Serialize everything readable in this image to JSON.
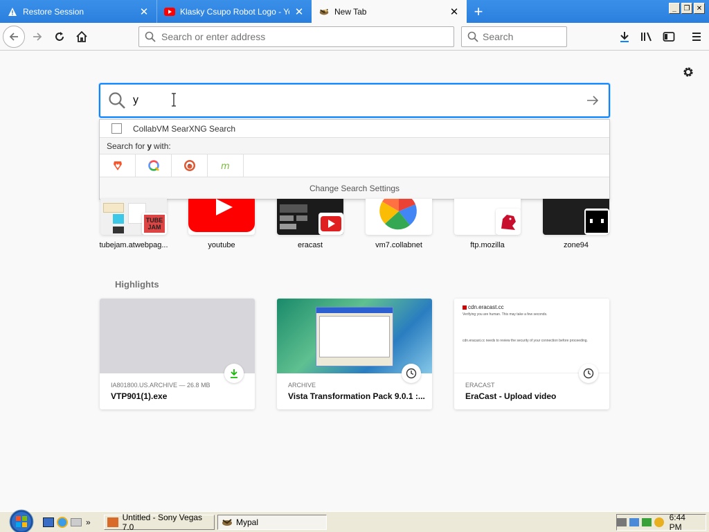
{
  "tabs": [
    {
      "title": "Restore Session",
      "icon": "warning-icon"
    },
    {
      "title": "Klasky Csupo Robot Logo - YouTube",
      "icon": "youtube-icon"
    },
    {
      "title": "New Tab",
      "icon": "mypal-icon"
    }
  ],
  "toolbar": {
    "url_placeholder": "Search or enter address",
    "search_placeholder": "Search"
  },
  "search": {
    "query": "y",
    "suggestion": "CollabVM SearXNG Search",
    "search_for_prefix": "Search for ",
    "search_for_term": "y",
    "search_for_suffix": " with:",
    "engines": [
      "brave-icon",
      "qwant-icon",
      "duckduckgo-icon",
      "mojeek-icon"
    ],
    "settings_label": "Change Search Settings"
  },
  "top_sites": [
    {
      "label": "tubejam.atwebpag..."
    },
    {
      "label": "youtube"
    },
    {
      "label": "eracast"
    },
    {
      "label": "vm7.collabnet"
    },
    {
      "label": "ftp.mozilla"
    },
    {
      "label": "zone94"
    }
  ],
  "highlights": {
    "title": "Highlights",
    "cards": [
      {
        "meta": "IA801800.US.ARCHIVE — 26.8 MB",
        "title": "VTP901(1).exe",
        "badge": "download-icon"
      },
      {
        "meta": "ARCHIVE",
        "title": "Vista Transformation Pack 9.0.1 :...",
        "badge": "clock-icon"
      },
      {
        "meta": "ERACAST",
        "title": "EraCast - Upload video",
        "badge": "clock-icon",
        "preview_url": "cdn.eracast.cc",
        "preview_line1": "Verifying you are human. This may take a few seconds.",
        "preview_line2": "cdn.eracast.cc needs to review the security of your connection before proceeding."
      }
    ]
  },
  "taskbar": {
    "tasks": [
      {
        "label": "Untitled - Sony Vegas 7.0"
      },
      {
        "label": "Mypal"
      }
    ],
    "clock": "6:44 PM"
  }
}
